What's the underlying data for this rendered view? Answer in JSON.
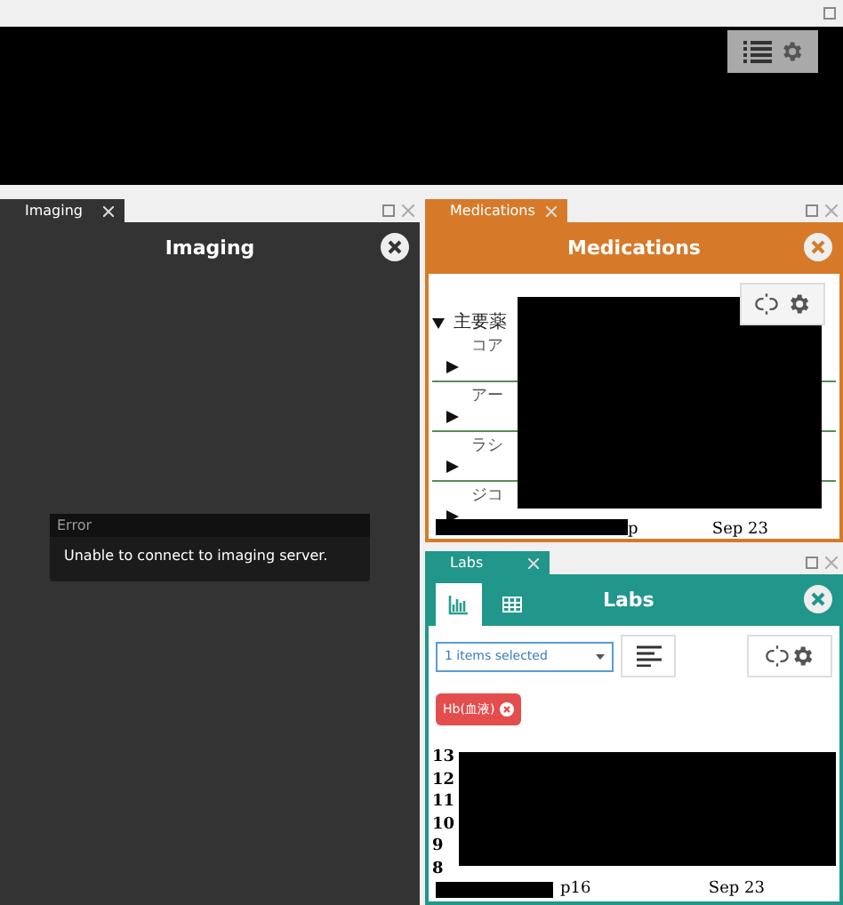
{
  "imaging": {
    "tab": {
      "label": "Imaging",
      "selected": true
    },
    "title": "Imaging",
    "error": {
      "heading": "Error",
      "message": "Unable to connect to imaging server."
    }
  },
  "medications": {
    "tab": {
      "label": "Medications",
      "selected": true
    },
    "title": "Medications",
    "group": {
      "label": "主要薬",
      "expanded": true,
      "items": [
        {
          "label": "コア",
          "expanded": false
        },
        {
          "label": "アー",
          "expanded": false
        },
        {
          "label": "ラシ",
          "expanded": false
        },
        {
          "label": "ジコ",
          "expanded": false
        }
      ]
    },
    "axis_labels": [
      "p",
      "Sep 23"
    ]
  },
  "labs": {
    "tab": {
      "label": "Labs",
      "selected": true
    },
    "views": [
      {
        "kind": "chart",
        "selected": true
      },
      {
        "kind": "table",
        "selected": false
      }
    ],
    "title": "Labs",
    "select": {
      "value": "1 items selected"
    },
    "tags": [
      {
        "label": "Hb(血液)"
      }
    ],
    "y_labels": [
      "13",
      "12",
      "11",
      "10",
      "9",
      "8"
    ],
    "x_labels": [
      "p16",
      "Sep 23"
    ]
  }
}
